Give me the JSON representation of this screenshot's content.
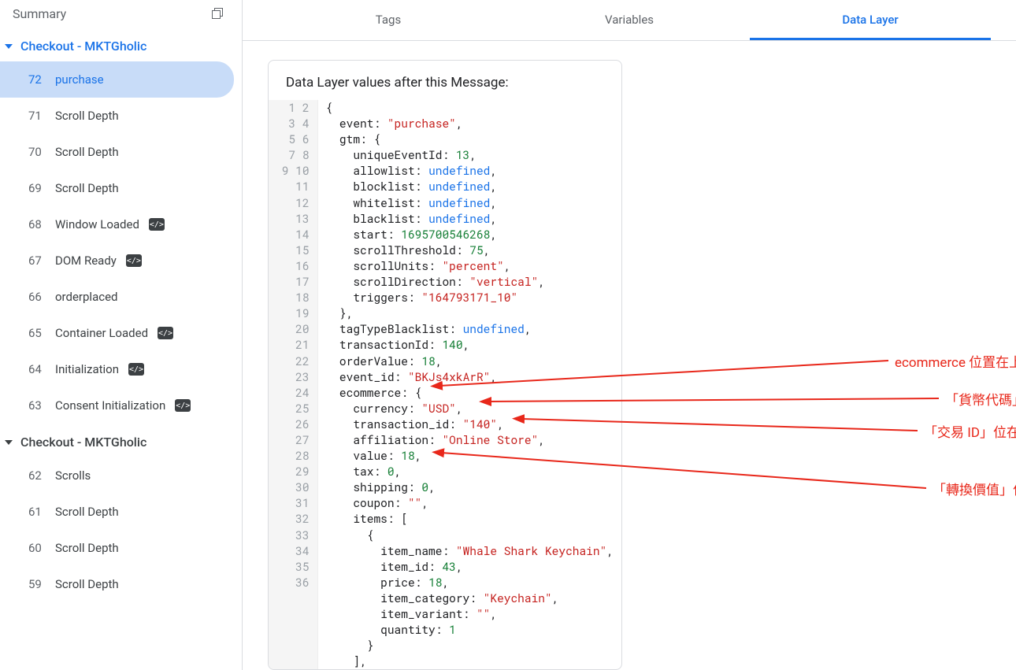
{
  "sidebar": {
    "summaryLabel": "Summary",
    "groups": [
      {
        "title": "Checkout - MKTGholic",
        "accent": true,
        "items": [
          {
            "num": "72",
            "label": "purchase",
            "active": true,
            "badge": false
          },
          {
            "num": "71",
            "label": "Scroll Depth",
            "badge": false
          },
          {
            "num": "70",
            "label": "Scroll Depth",
            "badge": false
          },
          {
            "num": "69",
            "label": "Scroll Depth",
            "badge": false
          },
          {
            "num": "68",
            "label": "Window Loaded",
            "badge": true
          },
          {
            "num": "67",
            "label": "DOM Ready",
            "badge": true
          },
          {
            "num": "66",
            "label": "orderplaced",
            "badge": false
          },
          {
            "num": "65",
            "label": "Container Loaded",
            "badge": true
          },
          {
            "num": "64",
            "label": "Initialization",
            "badge": true
          },
          {
            "num": "63",
            "label": "Consent Initialization",
            "badge": true
          }
        ]
      },
      {
        "title": "Checkout - MKTGholic",
        "accent": false,
        "items": [
          {
            "num": "62",
            "label": "Scrolls",
            "badge": false
          },
          {
            "num": "61",
            "label": "Scroll Depth",
            "badge": false
          },
          {
            "num": "60",
            "label": "Scroll Depth",
            "badge": false
          },
          {
            "num": "59",
            "label": "Scroll Depth",
            "badge": false
          }
        ]
      }
    ]
  },
  "tabs": {
    "items": [
      "Tags",
      "Variables",
      "Data Layer"
    ],
    "activeIndex": 2
  },
  "card": {
    "title": "Data Layer values after this Message:",
    "code": [
      [
        [
          "p",
          "{"
        ]
      ],
      [
        [
          "p",
          "  event: "
        ],
        [
          "s",
          "\"purchase\""
        ],
        [
          "p",
          ","
        ]
      ],
      [
        [
          "p",
          "  gtm: {"
        ]
      ],
      [
        [
          "p",
          "    uniqueEventId: "
        ],
        [
          "n",
          "13"
        ],
        [
          "p",
          ","
        ]
      ],
      [
        [
          "p",
          "    allowlist: "
        ],
        [
          "k",
          "undefined"
        ],
        [
          "p",
          ","
        ]
      ],
      [
        [
          "p",
          "    blocklist: "
        ],
        [
          "k",
          "undefined"
        ],
        [
          "p",
          ","
        ]
      ],
      [
        [
          "p",
          "    whitelist: "
        ],
        [
          "k",
          "undefined"
        ],
        [
          "p",
          ","
        ]
      ],
      [
        [
          "p",
          "    blacklist: "
        ],
        [
          "k",
          "undefined"
        ],
        [
          "p",
          ","
        ]
      ],
      [
        [
          "p",
          "    start: "
        ],
        [
          "n",
          "1695700546268"
        ],
        [
          "p",
          ","
        ]
      ],
      [
        [
          "p",
          "    scrollThreshold: "
        ],
        [
          "n",
          "75"
        ],
        [
          "p",
          ","
        ]
      ],
      [
        [
          "p",
          "    scrollUnits: "
        ],
        [
          "s",
          "\"percent\""
        ],
        [
          "p",
          ","
        ]
      ],
      [
        [
          "p",
          "    scrollDirection: "
        ],
        [
          "s",
          "\"vertical\""
        ],
        [
          "p",
          ","
        ]
      ],
      [
        [
          "p",
          "    triggers: "
        ],
        [
          "s",
          "\"164793171_10\""
        ]
      ],
      [
        [
          "p",
          "  },"
        ]
      ],
      [
        [
          "p",
          "  tagTypeBlacklist: "
        ],
        [
          "k",
          "undefined"
        ],
        [
          "p",
          ","
        ]
      ],
      [
        [
          "p",
          "  transactionId: "
        ],
        [
          "n",
          "140"
        ],
        [
          "p",
          ","
        ]
      ],
      [
        [
          "p",
          "  orderValue: "
        ],
        [
          "n",
          "18"
        ],
        [
          "p",
          ","
        ]
      ],
      [
        [
          "p",
          "  event_id: "
        ],
        [
          "s",
          "\"BKJs4xkArR\""
        ],
        [
          "p",
          ","
        ]
      ],
      [
        [
          "p",
          "  ecommerce: {"
        ]
      ],
      [
        [
          "p",
          "    currency: "
        ],
        [
          "s",
          "\"USD\""
        ],
        [
          "p",
          ","
        ]
      ],
      [
        [
          "p",
          "    transaction_id: "
        ],
        [
          "s",
          "\"140\""
        ],
        [
          "p",
          ","
        ]
      ],
      [
        [
          "p",
          "    affiliation: "
        ],
        [
          "s",
          "\"Online Store\""
        ],
        [
          "p",
          ","
        ]
      ],
      [
        [
          "p",
          "    value: "
        ],
        [
          "n",
          "18"
        ],
        [
          "p",
          ","
        ]
      ],
      [
        [
          "p",
          "    tax: "
        ],
        [
          "n",
          "0"
        ],
        [
          "p",
          ","
        ]
      ],
      [
        [
          "p",
          "    shipping: "
        ],
        [
          "n",
          "0"
        ],
        [
          "p",
          ","
        ]
      ],
      [
        [
          "p",
          "    coupon: "
        ],
        [
          "s",
          "\"\""
        ],
        [
          "p",
          ","
        ]
      ],
      [
        [
          "p",
          "    items: ["
        ]
      ],
      [
        [
          "p",
          "      {"
        ]
      ],
      [
        [
          "p",
          "        item_name: "
        ],
        [
          "s",
          "\"Whale Shark Keychain\""
        ],
        [
          "p",
          ","
        ]
      ],
      [
        [
          "p",
          "        item_id: "
        ],
        [
          "n",
          "43"
        ],
        [
          "p",
          ","
        ]
      ],
      [
        [
          "p",
          "        price: "
        ],
        [
          "n",
          "18"
        ],
        [
          "p",
          ","
        ]
      ],
      [
        [
          "p",
          "        item_category: "
        ],
        [
          "s",
          "\"Keychain\""
        ],
        [
          "p",
          ","
        ]
      ],
      [
        [
          "p",
          "        item_variant: "
        ],
        [
          "s",
          "\"\""
        ],
        [
          "p",
          ","
        ]
      ],
      [
        [
          "p",
          "        quantity: "
        ],
        [
          "n",
          "1"
        ]
      ],
      [
        [
          "p",
          "      }"
        ]
      ],
      [
        [
          "p",
          "    ],"
        ]
      ]
    ]
  },
  "annotations": {
    "a1": "ecommerce 位置在上層",
    "a2": "「貨幣代碼」位在 ecommerce 底下",
    "a3": "「交易 ID」位在 ecommerce 底下",
    "a4": "「轉換價值」位在 ecommerce 底下"
  }
}
